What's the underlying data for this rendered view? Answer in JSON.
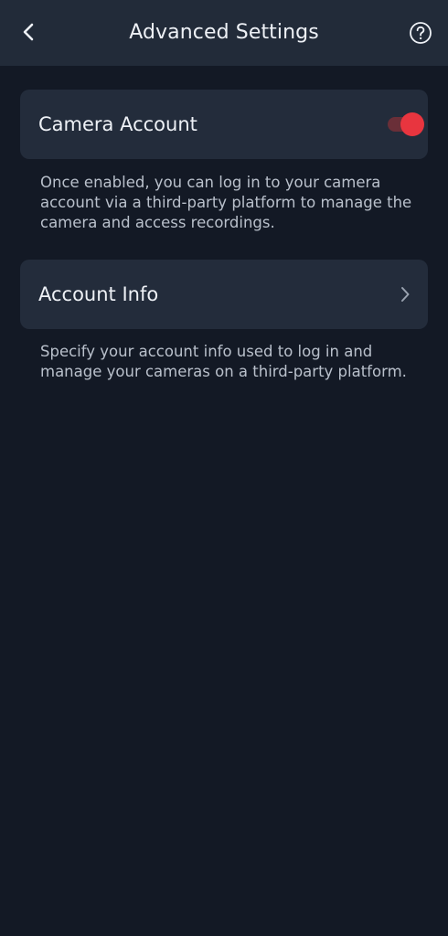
{
  "header": {
    "title": "Advanced Settings"
  },
  "camera_account": {
    "label": "Camera Account",
    "enabled": true,
    "description": "Once enabled, you can log in to your camera account via a third-party platform to manage the camera and access recordings."
  },
  "account_info": {
    "label": "Account Info",
    "description": "Specify your account info used to log in and manage your cameras on a third-party platform."
  },
  "colors": {
    "background": "#131925",
    "header": "#222b39",
    "card": "#232c3b",
    "toggle_on": "#e8353f",
    "toggle_track": "#6a2f38",
    "text_primary": "#eef1f6",
    "text_secondary": "#b9c0cb"
  },
  "icons": {
    "back": "back-arrow-icon",
    "help": "help-icon",
    "chevron": "chevron-right-icon"
  }
}
